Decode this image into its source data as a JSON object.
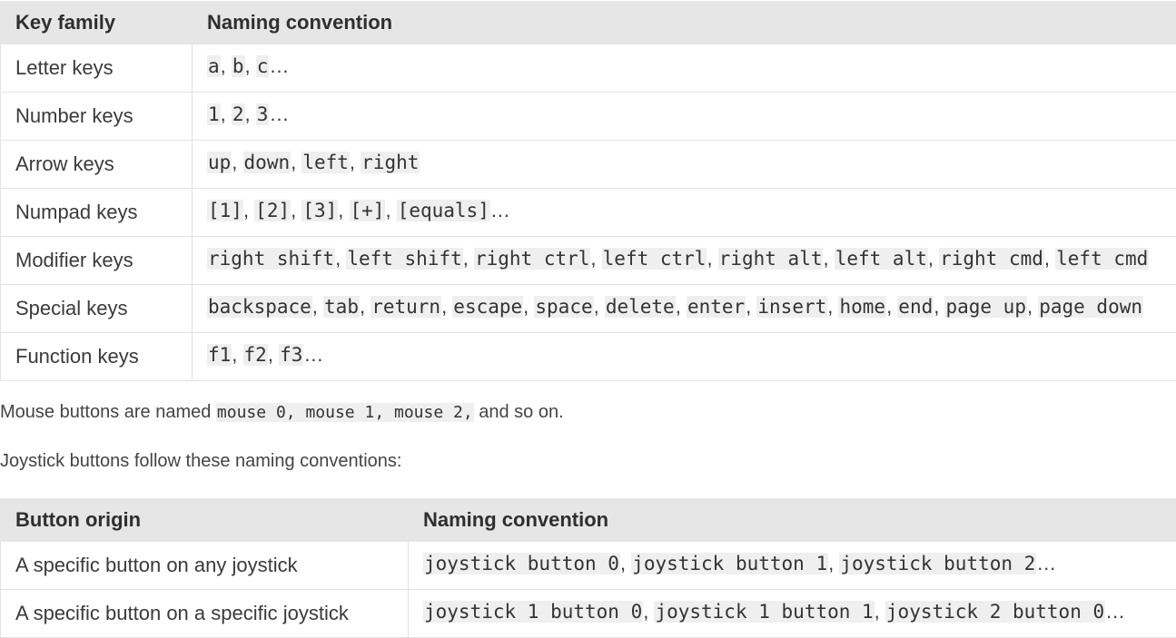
{
  "keys_table": {
    "headers": [
      "Key family",
      "Naming convention"
    ],
    "rows": [
      {
        "family": "Letter keys",
        "codes": [
          "a",
          "b",
          "c"
        ],
        "ellipsis": "…"
      },
      {
        "family": "Number keys",
        "codes": [
          "1",
          "2",
          "3"
        ],
        "ellipsis": "…"
      },
      {
        "family": "Arrow keys",
        "codes": [
          "up",
          "down",
          "left",
          "right"
        ],
        "ellipsis": ""
      },
      {
        "family": "Numpad keys",
        "codes": [
          "[1]",
          "[2]",
          "[3]",
          "[+]",
          "[equals]"
        ],
        "ellipsis": "…"
      },
      {
        "family": "Modifier keys",
        "codes": [
          "right shift",
          "left shift",
          "right ctrl",
          "left ctrl",
          "right alt",
          "left alt",
          "right cmd",
          "left cmd"
        ],
        "ellipsis": ""
      },
      {
        "family": "Special keys",
        "codes": [
          "backspace",
          "tab",
          "return",
          "escape",
          "space",
          "delete",
          "enter",
          "insert",
          "home",
          "end",
          "page up",
          "page down"
        ],
        "ellipsis": ""
      },
      {
        "family": "Function keys",
        "codes": [
          "f1",
          "f2",
          "f3"
        ],
        "ellipsis": "…"
      }
    ]
  },
  "mouse_paragraph": {
    "before": "Mouse buttons are named ",
    "code": "mouse 0, mouse 1, mouse 2,",
    "after": " and so on."
  },
  "joystick_paragraph": "Joystick buttons follow these naming conventions:",
  "joystick_table": {
    "headers": [
      "Button origin",
      "Naming convention"
    ],
    "rows": [
      {
        "origin": "A specific button on any joystick",
        "codes": [
          "joystick button 0",
          "joystick button 1",
          "joystick button 2"
        ],
        "ellipsis": "…"
      },
      {
        "origin": "A specific button on a specific joystick",
        "codes": [
          "joystick 1 button 0",
          "joystick 1 button 1",
          "joystick 2 button 0"
        ],
        "ellipsis": "…"
      }
    ]
  }
}
